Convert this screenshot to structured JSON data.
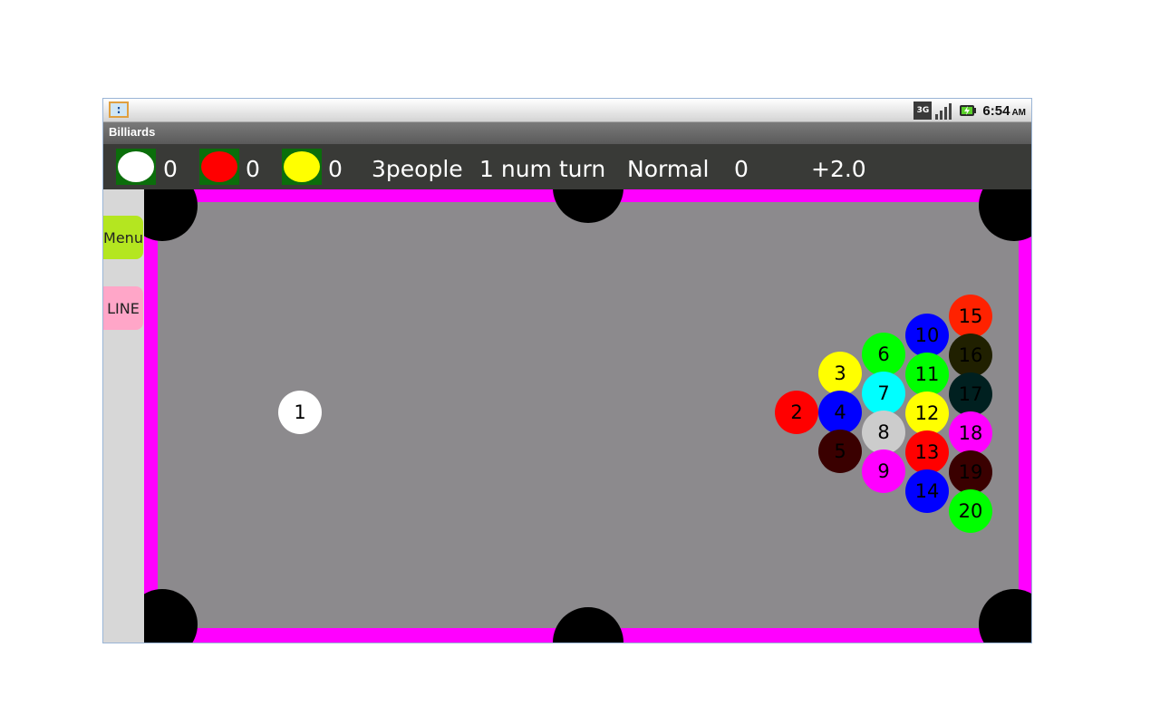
{
  "status_bar": {
    "network_label": "3G",
    "time": "6:54",
    "ampm": "AM",
    "notification_glyph": ":"
  },
  "app": {
    "title": "Billiards"
  },
  "score_bar": {
    "players": [
      {
        "color": "#ffffff",
        "score": "0"
      },
      {
        "color": "#ff0000",
        "score": "0"
      },
      {
        "color": "#ffff00",
        "score": "0"
      }
    ],
    "people": "3people",
    "turn": "1 num turn",
    "mode": "Normal",
    "count": "0",
    "power": "+2.0"
  },
  "sidebar": {
    "menu_label": "Menu",
    "line_label": "LINE"
  },
  "balls": [
    {
      "num": "1",
      "color": "#ffffff"
    },
    {
      "num": "2",
      "color": "#ff0000"
    },
    {
      "num": "3",
      "color": "#ffff00"
    },
    {
      "num": "4",
      "color": "#0000ff"
    },
    {
      "num": "5",
      "color": "#3a0000"
    },
    {
      "num": "6",
      "color": "#00ff00"
    },
    {
      "num": "7",
      "color": "#00ffff"
    },
    {
      "num": "8",
      "color": "#cccccc"
    },
    {
      "num": "9",
      "color": "#ff00ff"
    },
    {
      "num": "10",
      "color": "#0000ff"
    },
    {
      "num": "11",
      "color": "#00ff00"
    },
    {
      "num": "12",
      "color": "#ffff00"
    },
    {
      "num": "13",
      "color": "#ff0000"
    },
    {
      "num": "14",
      "color": "#0000ff"
    },
    {
      "num": "15",
      "color": "#ff2200"
    },
    {
      "num": "16",
      "color": "#202000"
    },
    {
      "num": "17",
      "color": "#002020"
    },
    {
      "num": "18",
      "color": "#ff00ff"
    },
    {
      "num": "19",
      "color": "#3a0000"
    },
    {
      "num": "20",
      "color": "#00ff00"
    }
  ]
}
